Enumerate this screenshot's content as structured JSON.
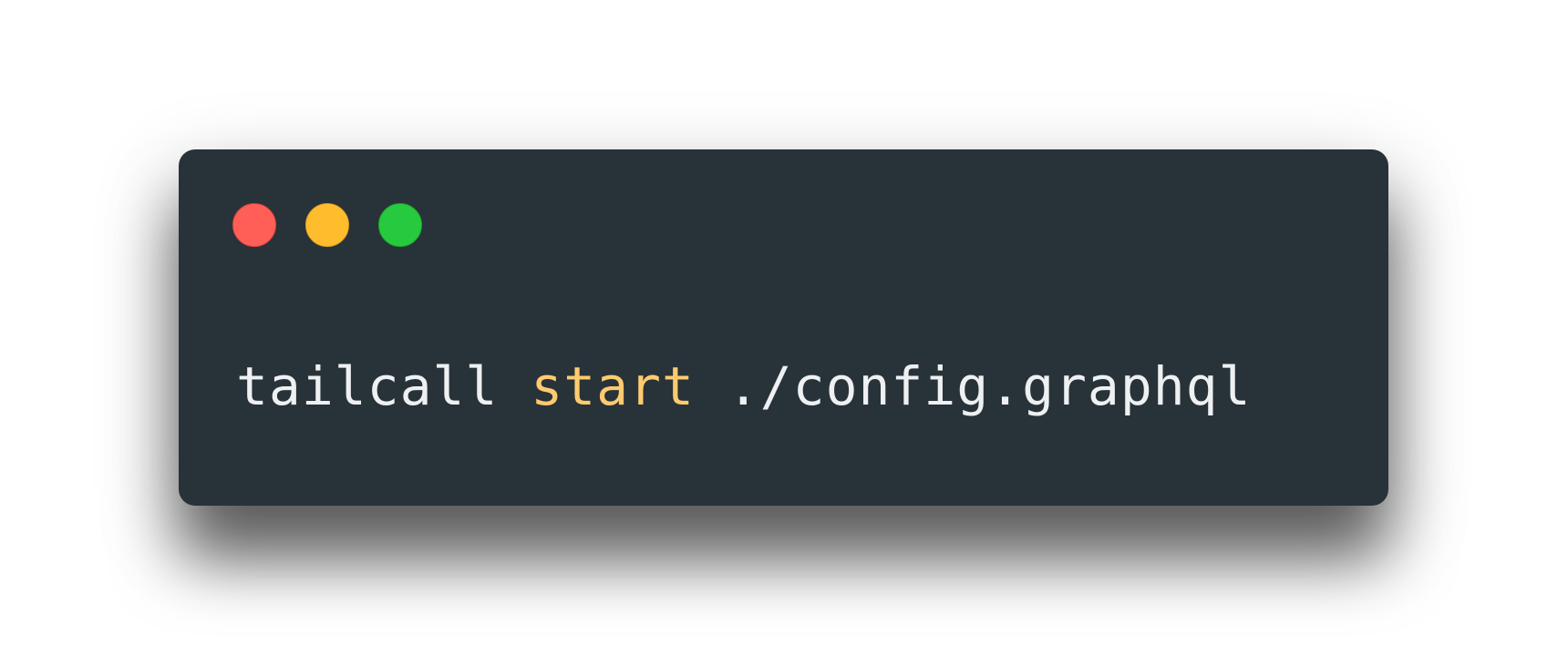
{
  "colors": {
    "page_background": "#ffffff",
    "window_background": "#283239",
    "default_text": "#eef0f1",
    "keyword_text": "#fdcb6e",
    "close_button": "#ff5f56",
    "minimize_button": "#ffbd2e",
    "zoom_button": "#27c93f"
  },
  "window_controls": [
    {
      "name": "close",
      "color": "#ff5f56"
    },
    {
      "name": "minimize",
      "color": "#ffbd2e"
    },
    {
      "name": "zoom",
      "color": "#27c93f"
    }
  ],
  "command": {
    "tokens": [
      {
        "text": "tailcall",
        "style": "default"
      },
      {
        "text": " ",
        "style": "default"
      },
      {
        "text": "start",
        "style": "keyword"
      },
      {
        "text": " ",
        "style": "default"
      },
      {
        "text": "./config.graphql",
        "style": "default"
      }
    ]
  }
}
